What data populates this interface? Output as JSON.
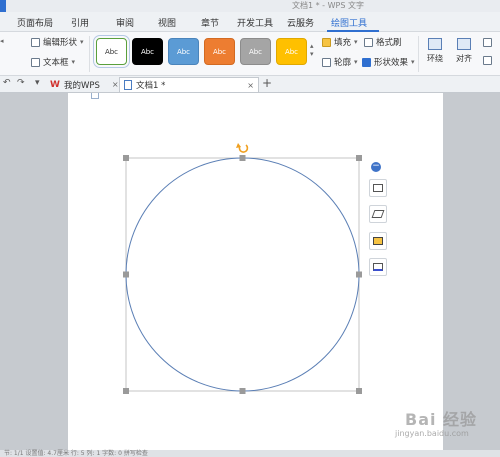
{
  "window": {
    "title": "文档1 * - WPS 文字"
  },
  "menu": {
    "tabs": [
      {
        "label": "页面布局"
      },
      {
        "label": "引用"
      },
      {
        "label": "审阅"
      },
      {
        "label": "视图"
      },
      {
        "label": "章节"
      },
      {
        "label": "开发工具"
      },
      {
        "label": "云服务"
      },
      {
        "label": "绘图工具"
      }
    ],
    "active_tab": "绘图工具"
  },
  "ribbon": {
    "edit_shape": "编辑形状",
    "text_box": "文本框",
    "styles": [
      {
        "label": "Abc",
        "fill": "#ffffff",
        "border": "#5aa03c",
        "text": "#333333"
      },
      {
        "label": "Abc",
        "fill": "#000000",
        "border": "#000000",
        "text": "#ffffff"
      },
      {
        "label": "Abc",
        "fill": "#5b9bd5",
        "border": "#4a84bb",
        "text": "#ffffff"
      },
      {
        "label": "Abc",
        "fill": "#ed7d31",
        "border": "#d26a22",
        "text": "#ffffff"
      },
      {
        "label": "Abc",
        "fill": "#a5a5a5",
        "border": "#8c8c8c",
        "text": "#ffffff"
      },
      {
        "label": "Abc",
        "fill": "#ffc000",
        "border": "#e0a800",
        "text": "#ffffff"
      }
    ],
    "fill": "填充",
    "format_painter": "格式刷",
    "outline": "轮廓",
    "shape_effects": "形状效果",
    "wrap": "环绕",
    "align": "对齐"
  },
  "doc_tabs": {
    "home": "我的WPS",
    "document": "文档1 *",
    "add": "+"
  },
  "canvas": {
    "shape": "circle",
    "stroke_color": "#5b7fb5",
    "handle_color": "#9a9a9a",
    "rotate_color": "#f0a020"
  },
  "statusbar": {
    "text": "节: 1/1  设置值: 4.7厘米  行: 5  列: 1  字数: 0  拼写检查"
  },
  "watermark": {
    "brand": "Bai 经验",
    "url": "jingyan.baidu.com"
  }
}
